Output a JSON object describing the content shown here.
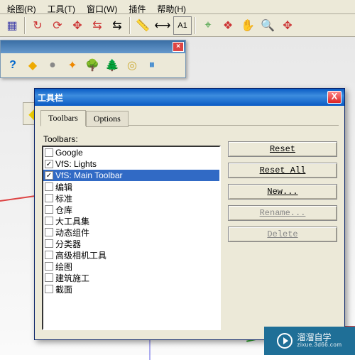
{
  "menu": {
    "items": [
      "绘图(R)",
      "工具(T)",
      "窗口(W)",
      "插件",
      "帮助(H)"
    ]
  },
  "toolbar": {
    "icons": [
      "layers-icon",
      "|",
      "redo-icon",
      "redo-loop-icon",
      "arrows-4-icon",
      "sync-red-icon",
      "sync-black-icon",
      "|",
      "tape-icon",
      "dimension-icon",
      "text-label-icon",
      "|",
      "walk-icon",
      "orbit-green-icon",
      "hand-icon",
      "zoom-icon",
      "zoom-target-icon"
    ]
  },
  "floating": {
    "icons": [
      "help-icon",
      "tag-yellow-icon",
      "sphere-icon",
      "layers-orange-icon",
      "tree1-icon",
      "tree2-icon",
      "target-icon",
      "pause-icon"
    ]
  },
  "pick_icon_label": "pick-yellow-icon",
  "dialog": {
    "title": "工具栏",
    "tabs": [
      "Toolbars",
      "Options"
    ],
    "list_label": "Toolbars:",
    "items": [
      {
        "label": "Google",
        "checked": false,
        "sel": false
      },
      {
        "label": "VfS: Lights",
        "checked": true,
        "sel": false
      },
      {
        "label": "VfS: Main Toolbar",
        "checked": true,
        "sel": true
      },
      {
        "label": "编辑",
        "checked": false,
        "sel": false
      },
      {
        "label": "标准",
        "checked": false,
        "sel": false
      },
      {
        "label": "仓库",
        "checked": false,
        "sel": false
      },
      {
        "label": "大工具集",
        "checked": false,
        "sel": false
      },
      {
        "label": "动态组件",
        "checked": false,
        "sel": false
      },
      {
        "label": "分类器",
        "checked": false,
        "sel": false
      },
      {
        "label": "高级相机工具",
        "checked": false,
        "sel": false
      },
      {
        "label": "绘图",
        "checked": false,
        "sel": false
      },
      {
        "label": "建筑施工",
        "checked": false,
        "sel": false
      },
      {
        "label": "截面",
        "checked": false,
        "sel": false
      }
    ],
    "buttons": {
      "reset": "Reset",
      "reset_all": "Reset All",
      "new": "New...",
      "rename": "Rename...",
      "delete": "Delete"
    }
  },
  "watermark": {
    "brand": "溜溜自学",
    "sub": "zixue.3d66.com"
  }
}
